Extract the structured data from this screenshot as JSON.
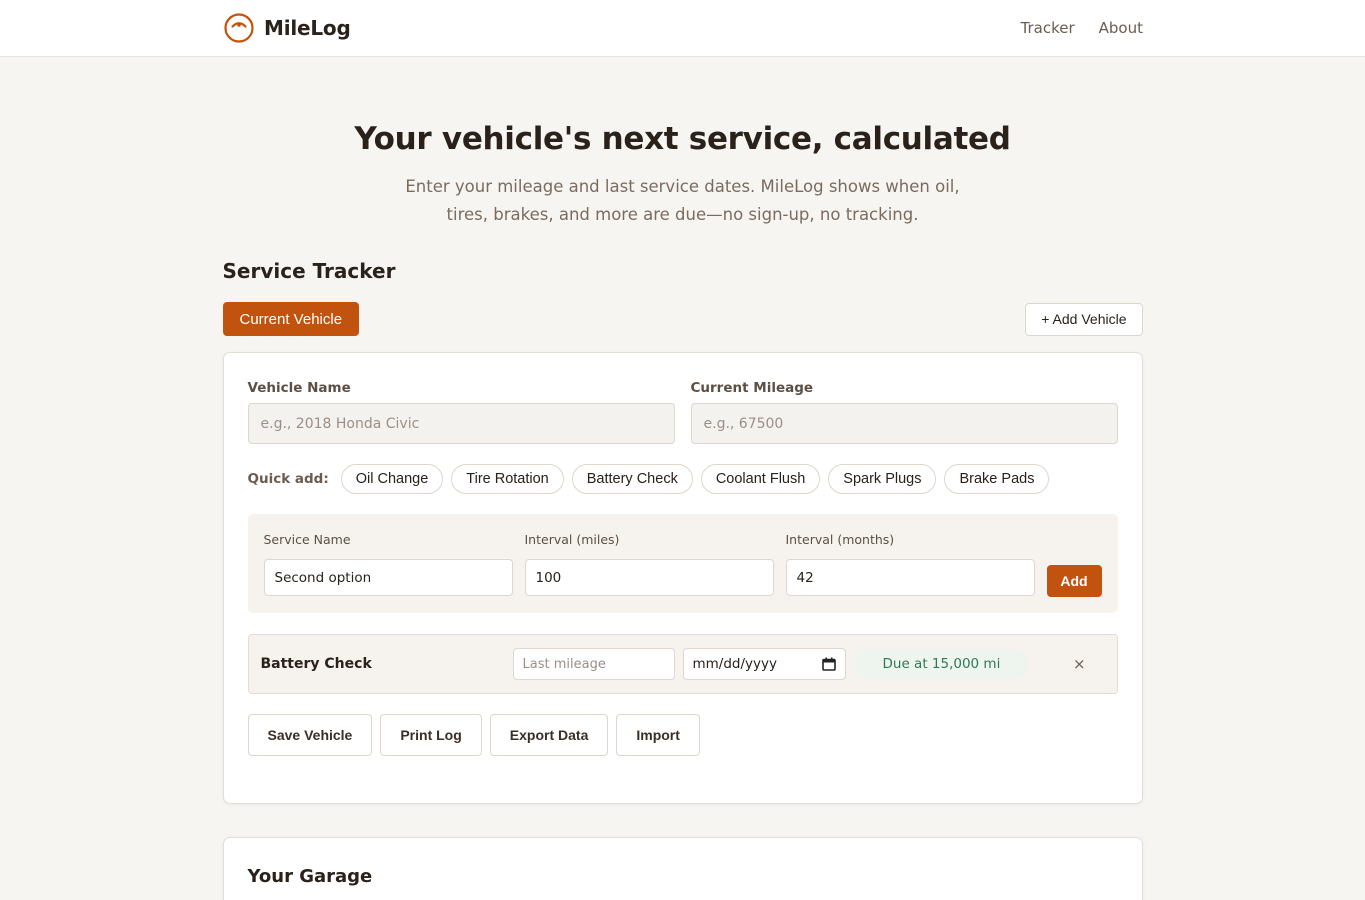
{
  "brand": {
    "name": "MileLog",
    "accent": "#c2530f"
  },
  "nav": {
    "items": [
      "Tracker",
      "About"
    ]
  },
  "hero": {
    "title": "Your vehicle's next service, calculated",
    "subtitle": "Enter your mileage and last service dates. MileLog shows when oil, tires, brakes, and more are due—no sign-up, no tracking."
  },
  "tracker": {
    "title": "Service Tracker",
    "current_vehicle_label": "Current Vehicle",
    "add_vehicle_label": "+ Add Vehicle",
    "vehicle_name": {
      "label": "Vehicle Name",
      "placeholder": "e.g., 2018 Honda Civic",
      "value": ""
    },
    "current_mileage": {
      "label": "Current Mileage",
      "placeholder": "e.g., 67500",
      "value": ""
    },
    "quick_add": {
      "label": "Quick add:",
      "chips": [
        "Oil Change",
        "Tire Rotation",
        "Battery Check",
        "Coolant Flush",
        "Spark Plugs",
        "Brake Pads"
      ]
    },
    "add_service": {
      "service_name": {
        "label": "Service Name",
        "value": "Second option"
      },
      "interval_miles": {
        "label": "Interval (miles)",
        "value": "100"
      },
      "interval_months": {
        "label": "Interval (months)",
        "value": "42"
      },
      "add_label": "Add"
    },
    "services": [
      {
        "name": "Battery Check",
        "last_mileage_placeholder": "Last mileage",
        "date_placeholder": "mm/dd/yyyy",
        "due": "Due at 15,000 mi",
        "remove_symbol": "×"
      }
    ],
    "actions": [
      "Save Vehicle",
      "Print Log",
      "Export Data",
      "Import"
    ]
  },
  "garage": {
    "title": "Your Garage"
  },
  "colors": {
    "due_text": "#2f7a55",
    "due_bg": "#eef4ee",
    "page_bg": "#f7f5f2"
  }
}
